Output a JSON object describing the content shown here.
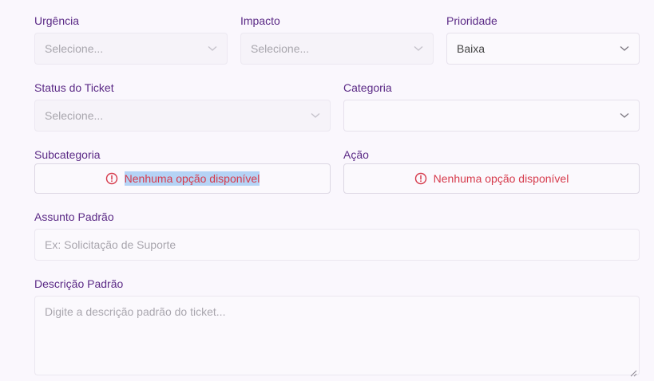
{
  "fields": {
    "urgencia": {
      "label": "Urgência",
      "value": "Selecione..."
    },
    "impacto": {
      "label": "Impacto",
      "value": "Selecione..."
    },
    "prioridade": {
      "label": "Prioridade",
      "value": "Baixa"
    },
    "status": {
      "label": "Status do Ticket",
      "value": "Selecione..."
    },
    "categoria": {
      "label": "Categoria",
      "value": ""
    },
    "subcategoria": {
      "label": "Subcategoria",
      "message": "Nenhuma opção disponível"
    },
    "acao": {
      "label": "Ação",
      "message": "Nenhuma opção disponível"
    },
    "assunto": {
      "label": "Assunto Padrão",
      "placeholder": "Ex: Solicitação de Suporte"
    },
    "descricao": {
      "label": "Descrição Padrão",
      "placeholder": "Digite a descrição padrão do ticket..."
    }
  },
  "colors": {
    "label": "#5b2a86",
    "error": "#d63a4b",
    "selection": "#b5d3f5"
  }
}
